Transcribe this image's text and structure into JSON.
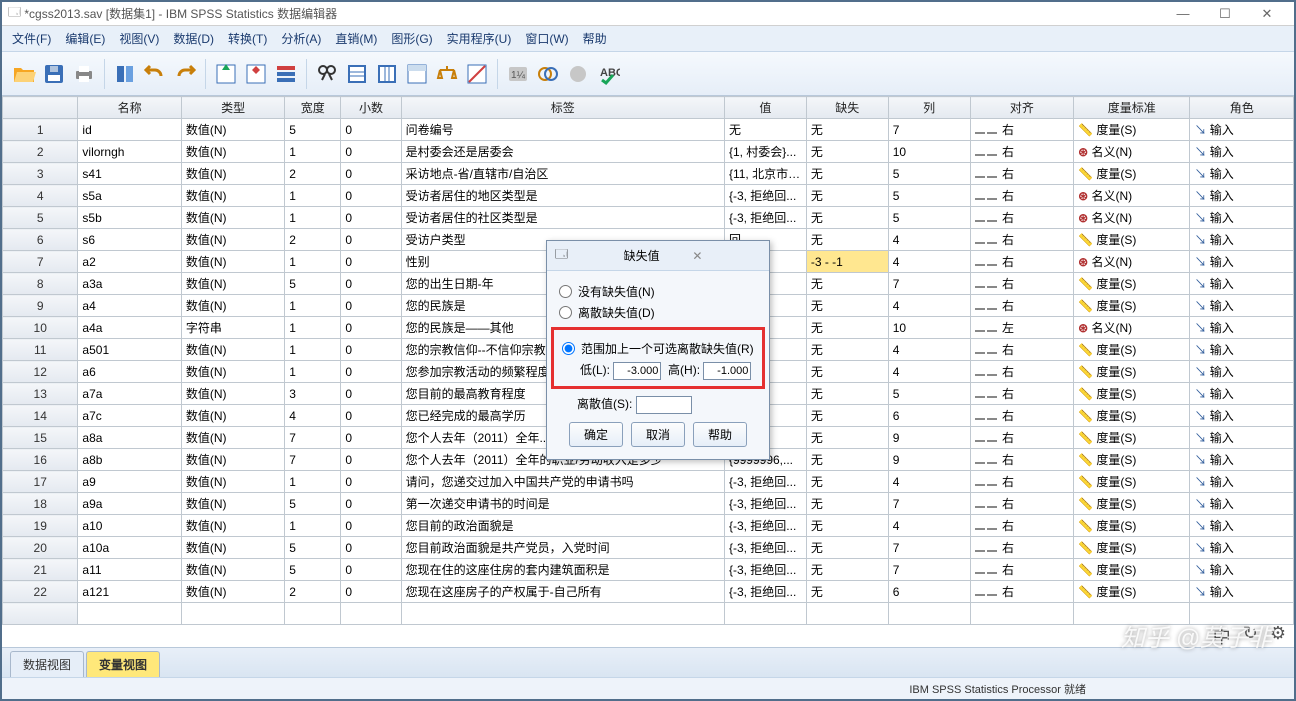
{
  "title": "*cgss2013.sav [数据集1] - IBM SPSS Statistics 数据编辑器",
  "winbtns": {
    "min": "—",
    "max": "☐",
    "close": "✕"
  },
  "menu": [
    "文件(F)",
    "编辑(E)",
    "视图(V)",
    "数据(D)",
    "转换(T)",
    "分析(A)",
    "直销(M)",
    "图形(G)",
    "实用程序(U)",
    "窗口(W)",
    "帮助"
  ],
  "headers": [
    "名称",
    "类型",
    "宽度",
    "小数",
    "标签",
    "值",
    "缺失",
    "列",
    "对齐",
    "度量标准",
    "角色"
  ],
  "align_label": "右",
  "align_left_label": "左",
  "role_label": "输入",
  "rows": [
    {
      "n": "id",
      "t": "数值(N)",
      "w": "5",
      "d": "0",
      "lab": "问卷编号",
      "val": "无",
      "miss": "无",
      "col": "7",
      "align": "右",
      "meas": "度量(S)",
      "mi": "s",
      "role": "输入"
    },
    {
      "n": "vilorngh",
      "t": "数值(N)",
      "w": "1",
      "d": "0",
      "lab": "是村委会还是居委会",
      "val": "{1, 村委会}...",
      "miss": "无",
      "col": "10",
      "align": "右",
      "meas": "名义(N)",
      "mi": "n",
      "role": "输入"
    },
    {
      "n": "s41",
      "t": "数值(N)",
      "w": "2",
      "d": "0",
      "lab": "采访地点-省/直辖市/自治区",
      "val": "{11, 北京市}...",
      "miss": "无",
      "col": "5",
      "align": "右",
      "meas": "度量(S)",
      "mi": "s",
      "role": "输入"
    },
    {
      "n": "s5a",
      "t": "数值(N)",
      "w": "1",
      "d": "0",
      "lab": "受访者居住的地区类型是",
      "val": "{-3, 拒绝回...",
      "miss": "无",
      "col": "5",
      "align": "右",
      "meas": "名义(N)",
      "mi": "n",
      "role": "输入"
    },
    {
      "n": "s5b",
      "t": "数值(N)",
      "w": "1",
      "d": "0",
      "lab": "受访者居住的社区类型是",
      "val": "{-3, 拒绝回...",
      "miss": "无",
      "col": "5",
      "align": "右",
      "meas": "名义(N)",
      "mi": "n",
      "role": "输入"
    },
    {
      "n": "s6",
      "t": "数值(N)",
      "w": "2",
      "d": "0",
      "lab": "受访户类型",
      "val": "回...",
      "miss": "无",
      "col": "4",
      "align": "右",
      "meas": "度量(S)",
      "mi": "s",
      "role": "输入"
    },
    {
      "n": "a2",
      "t": "数值(N)",
      "w": "1",
      "d": "0",
      "lab": "性别",
      "val": "回...",
      "miss": "-3 - -1",
      "col": "4",
      "align": "右",
      "meas": "名义(N)",
      "mi": "n",
      "role": "输入",
      "hl": true
    },
    {
      "n": "a3a",
      "t": "数值(N)",
      "w": "5",
      "d": "0",
      "lab": "您的出生日期-年",
      "val": "回...",
      "miss": "无",
      "col": "7",
      "align": "右",
      "meas": "度量(S)",
      "mi": "s",
      "role": "输入"
    },
    {
      "n": "a4",
      "t": "数值(N)",
      "w": "1",
      "d": "0",
      "lab": "您的民族是",
      "val": "回...",
      "miss": "无",
      "col": "4",
      "align": "右",
      "meas": "度量(S)",
      "mi": "s",
      "role": "输入"
    },
    {
      "n": "a4a",
      "t": "字符串",
      "w": "1",
      "d": "0",
      "lab": "您的民族是——其他",
      "val": "",
      "miss": "无",
      "col": "10",
      "align": "左",
      "meas": "名义(N)",
      "mi": "n",
      "role": "输入"
    },
    {
      "n": "a501",
      "t": "数值(N)",
      "w": "1",
      "d": "0",
      "lab": "您的宗教信仰--不信仰宗教",
      "val": "回...",
      "miss": "无",
      "col": "4",
      "align": "右",
      "meas": "度量(S)",
      "mi": "s",
      "role": "输入"
    },
    {
      "n": "a6",
      "t": "数值(N)",
      "w": "1",
      "d": "0",
      "lab": "您参加宗教活动的频繁程度",
      "val": "回...",
      "miss": "无",
      "col": "4",
      "align": "右",
      "meas": "度量(S)",
      "mi": "s",
      "role": "输入"
    },
    {
      "n": "a7a",
      "t": "数值(N)",
      "w": "3",
      "d": "0",
      "lab": "您目前的最高教育程度",
      "val": "回...",
      "miss": "无",
      "col": "5",
      "align": "右",
      "meas": "度量(S)",
      "mi": "s",
      "role": "输入"
    },
    {
      "n": "a7c",
      "t": "数值(N)",
      "w": "4",
      "d": "0",
      "lab": "您已经完成的最高学历",
      "val": "回...",
      "miss": "无",
      "col": "6",
      "align": "右",
      "meas": "度量(S)",
      "mi": "s",
      "role": "输入"
    },
    {
      "n": "a8a",
      "t": "数值(N)",
      "w": "7",
      "d": "0",
      "lab": "您个人去年（2011）全年...",
      "val": "6,...",
      "miss": "无",
      "col": "9",
      "align": "右",
      "meas": "度量(S)",
      "mi": "s",
      "role": "输入"
    },
    {
      "n": "a8b",
      "t": "数值(N)",
      "w": "7",
      "d": "0",
      "lab": "您个人去年（2011）全年的职业/劳动收入是多少",
      "val": "{9999996,...",
      "miss": "无",
      "col": "9",
      "align": "右",
      "meas": "度量(S)",
      "mi": "s",
      "role": "输入"
    },
    {
      "n": "a9",
      "t": "数值(N)",
      "w": "1",
      "d": "0",
      "lab": "请问，您递交过加入中国共产党的申请书吗",
      "val": "{-3, 拒绝回...",
      "miss": "无",
      "col": "4",
      "align": "右",
      "meas": "度量(S)",
      "mi": "s",
      "role": "输入"
    },
    {
      "n": "a9a",
      "t": "数值(N)",
      "w": "5",
      "d": "0",
      "lab": "第一次递交申请书的时间是",
      "val": "{-3, 拒绝回...",
      "miss": "无",
      "col": "7",
      "align": "右",
      "meas": "度量(S)",
      "mi": "s",
      "role": "输入"
    },
    {
      "n": "a10",
      "t": "数值(N)",
      "w": "1",
      "d": "0",
      "lab": "您目前的政治面貌是",
      "val": "{-3, 拒绝回...",
      "miss": "无",
      "col": "4",
      "align": "右",
      "meas": "度量(S)",
      "mi": "s",
      "role": "输入"
    },
    {
      "n": "a10a",
      "t": "数值(N)",
      "w": "5",
      "d": "0",
      "lab": "您目前政治面貌是共产党员，入党时间",
      "val": "{-3, 拒绝回...",
      "miss": "无",
      "col": "7",
      "align": "右",
      "meas": "度量(S)",
      "mi": "s",
      "role": "输入"
    },
    {
      "n": "a11",
      "t": "数值(N)",
      "w": "5",
      "d": "0",
      "lab": "您现在住的这座住房的套内建筑面积是",
      "val": "{-3, 拒绝回...",
      "miss": "无",
      "col": "7",
      "align": "右",
      "meas": "度量(S)",
      "mi": "s",
      "role": "输入"
    },
    {
      "n": "a121",
      "t": "数值(N)",
      "w": "2",
      "d": "0",
      "lab": "您现在这座房子的产权属于-自己所有",
      "val": "{-3, 拒绝回...",
      "miss": "无",
      "col": "6",
      "align": "右",
      "meas": "度量(S)",
      "mi": "s",
      "role": "输入"
    }
  ],
  "tabs": {
    "data": "数据视图",
    "var": "变量视图"
  },
  "status": "IBM SPSS Statistics Processor 就绪",
  "dialog": {
    "title": "缺失值",
    "r1": "没有缺失值(N)",
    "r2": "离散缺失值(D)",
    "r3": "范围加上一个可选离散缺失值(R)",
    "low": "低(L):",
    "high": "高(H):",
    "lowv": "-3.000",
    "highv": "-1.000",
    "discrete": "离散值(S):",
    "ok": "确定",
    "cancel": "取消",
    "help": "帮助"
  },
  "watermark": "知乎 @莫子非"
}
